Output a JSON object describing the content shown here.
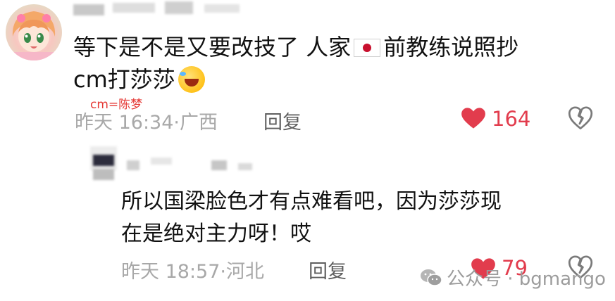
{
  "comment": {
    "text_line1_a": "等下是不是又要改技了 人家",
    "text_line1_b": "前教练说照抄",
    "text_line2": "cm打莎莎",
    "flag_icon": "japan-flag-icon",
    "emoji_icon": "rofl-emoji-icon",
    "annotation": "cm=陈梦",
    "time": "昨天 16:34",
    "location": "广西",
    "reply_label": "回复",
    "like_count": "164",
    "heart_color": "#e23c4d"
  },
  "reply": {
    "text_line1": "所以国梁脸色才有点难看吧，因为莎莎现",
    "text_line2": "在是绝对主力呀！哎",
    "time": "昨天 18:57",
    "location": "河北",
    "reply_label": "回复",
    "like_count": "79"
  },
  "watermark": {
    "text": "公众号 · bgmango",
    "icon": "wechat-icon"
  }
}
